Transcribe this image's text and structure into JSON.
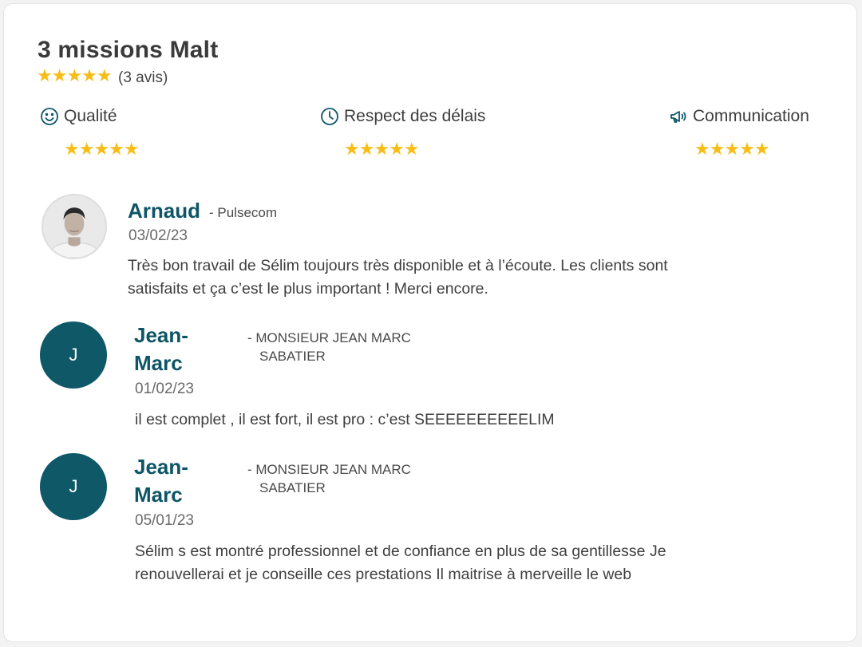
{
  "header": {
    "title": "3 missions Malt",
    "rating_stars": "★★★★★",
    "review_count": "(3 avis)"
  },
  "criteria": [
    {
      "label": "Qualité",
      "icon": "smiley-icon",
      "stars": "★★★★★"
    },
    {
      "label": "Respect des délais",
      "icon": "clock-icon",
      "stars": "★★★★★"
    },
    {
      "label": "Communication",
      "icon": "megaphone-icon",
      "stars": "★★★★★"
    }
  ],
  "reviews": [
    {
      "name": "Arnaud",
      "company": "- Pulsecom",
      "date": "03/02/23",
      "avatar": "photo",
      "comment_lines": [
        "Très bon travail de Sélim toujours très disponible et à l’écoute. Les clients sont",
        "satisfaits et ça c’est le plus important ! Merci encore."
      ]
    },
    {
      "name_lines": [
        "Jean-",
        "Marc"
      ],
      "company_lines": [
        "- MONSIEUR JEAN MARC",
        "SABATIER"
      ],
      "date": "01/02/23",
      "avatar_letter": "J",
      "comment_lines": [
        "il est complet , il est fort, il est pro : c’est SEEEEEEEEEELIM"
      ]
    },
    {
      "name_lines": [
        "Jean-",
        "Marc"
      ],
      "company_lines": [
        "- MONSIEUR JEAN MARC",
        "SABATIER"
      ],
      "date": "05/01/23",
      "avatar_letter": "J",
      "comment_lines": [
        "Sélim s est montré professionnel et de confiance en plus de sa gentillesse Je",
        "renouvellerai et je conseille ces prestations Il maitrise à merveille le web"
      ]
    }
  ],
  "colors": {
    "accent": "#0e5868",
    "star": "#f7bd16",
    "text": "#3d3d3d"
  }
}
